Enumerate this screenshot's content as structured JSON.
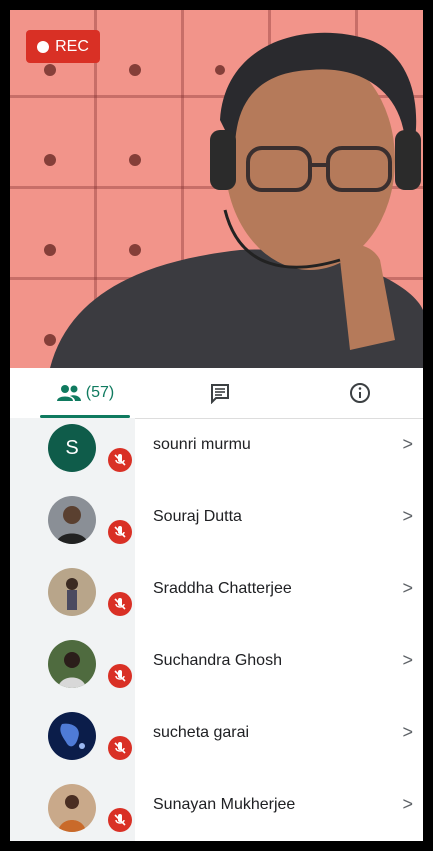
{
  "recording": {
    "label": "REC"
  },
  "tabs": {
    "people_count": "(57)"
  },
  "participants": [
    {
      "name": "sounri murmu",
      "avatar_letter": "S",
      "avatar_color": "#0f5c4a"
    },
    {
      "name": "Souraj Dutta"
    },
    {
      "name": "Sraddha Chatterjee"
    },
    {
      "name": "Suchandra Ghosh"
    },
    {
      "name": "sucheta garai"
    },
    {
      "name": "Sunayan Mukherjee"
    }
  ],
  "colors": {
    "accent": "#0f7a5f",
    "mute_red": "#d93025",
    "rec_red": "#d93025"
  }
}
